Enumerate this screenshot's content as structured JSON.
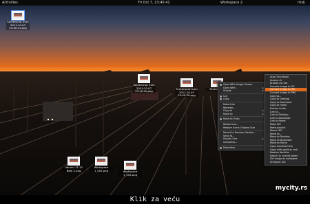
{
  "topbar": {
    "activities": "Activities",
    "clock": "Fri Oct 7, 23:40:41",
    "workspace": "Workspace 2",
    "user": "rrisk"
  },
  "desktop_icons": [
    {
      "label": "Screenshot from 2011-10-07 23:40:11.png",
      "selected": true
    },
    {
      "label": "Screenshot from 2011-10-07 23:40:22.png",
      "selected": false
    },
    {
      "label": "Screenshot from 2011-10-07 23:40:30.png",
      "selected": false
    },
    {
      "label": "Ubuntu 11.10 Beta 2.png",
      "selected": false
    },
    {
      "label": "Workspace 1_002.png",
      "selected": false
    },
    {
      "label": "Workspace 1_003.png",
      "selected": false
    },
    {
      "label": "Screenshot",
      "selected": false
    }
  ],
  "context_menu": {
    "items": [
      {
        "label": "Open With Image Viewer",
        "icon": "image-viewer-icon",
        "submenu": false
      },
      {
        "label": "Open With",
        "icon": "",
        "submenu": true
      },
      {
        "label": "Scripts",
        "icon": "",
        "submenu": true
      },
      {
        "sep": true
      },
      {
        "label": "Cut",
        "icon": "cut-icon",
        "submenu": false
      },
      {
        "label": "Copy",
        "icon": "copy-icon",
        "submenu": false
      },
      {
        "sep": true
      },
      {
        "label": "Make Link",
        "icon": "",
        "submenu": false
      },
      {
        "label": "Rename...",
        "icon": "",
        "submenu": false
      },
      {
        "label": "Copy to",
        "icon": "",
        "submenu": true
      },
      {
        "label": "Move to",
        "icon": "",
        "submenu": true
      },
      {
        "sep": true
      },
      {
        "label": "Move to Trash",
        "icon": "trash-icon",
        "submenu": false
      },
      {
        "sep": true
      },
      {
        "label": "Resize Icon...",
        "icon": "",
        "submenu": false
      },
      {
        "label": "Restore Icon's Original Size",
        "icon": "",
        "submenu": false
      },
      {
        "sep": true
      },
      {
        "label": "Revert to Previous Version...",
        "icon": "",
        "submenu": false
      },
      {
        "label": "Send To...",
        "icon": "",
        "submenu": false
      },
      {
        "label": "Ubuntu One",
        "icon": "",
        "submenu": true
      },
      {
        "label": "Compress...",
        "icon": "",
        "submenu": false
      },
      {
        "sep": true
      },
      {
        "label": "Properties",
        "icon": "properties-icon",
        "submenu": false
      }
    ]
  },
  "scripts_menu": {
    "items": [
      {
        "label": "Auto Thumbnail",
        "highlighted": false
      },
      {
        "label": "Autorun.fr",
        "highlighted": false
      },
      {
        "label": "Browse as root",
        "highlighted": false
      },
      {
        "label": "Convert image to Gif",
        "highlighted": false
      },
      {
        "label": "Convert image to JPG",
        "highlighted": true
      },
      {
        "label": "Convert image to PNG",
        "highlighted": false
      },
      {
        "label": "Copy to...",
        "highlighted": false
      },
      {
        "label": "Copy to Desktop",
        "highlighted": false
      },
      {
        "label": "Copy to Download",
        "highlighted": false
      },
      {
        "label": "Copy to Home",
        "highlighted": false
      },
      {
        "label": "Extract Audio",
        "highlighted": false
      },
      {
        "label": "Link to...",
        "highlighted": false
      },
      {
        "label": "Link to Desktop",
        "highlighted": false
      },
      {
        "label": "Link to Download",
        "highlighted": false
      },
      {
        "label": "Link to Home",
        "highlighted": false
      },
      {
        "label": "Make ISO",
        "highlighted": false
      },
      {
        "label": "Make playlist",
        "highlighted": false
      },
      {
        "label": "Mount ISO",
        "highlighted": false
      },
      {
        "label": "Move to...",
        "highlighted": false
      },
      {
        "label": "Move to Desktop",
        "highlighted": false
      },
      {
        "label": "Move to Download",
        "highlighted": false
      },
      {
        "label": "Move to Home",
        "highlighted": false
      },
      {
        "label": "Open terminal here",
        "highlighted": false
      },
      {
        "label": "Open with gedit as root",
        "highlighted": false
      },
      {
        "label": "Restore Nautilus",
        "highlighted": false
      },
      {
        "label": "Search in current folder",
        "highlighted": false
      },
      {
        "label": "Set image as wallpaper",
        "highlighted": false
      },
      {
        "label": "Unmount ISO",
        "highlighted": false
      }
    ]
  },
  "caption": "Klik za veću",
  "watermark": "mycity.rs",
  "colors": {
    "accent": "#e06a1c",
    "menu_bg": "#2b2b2b",
    "topbar_bg": "#0a0a0a"
  }
}
